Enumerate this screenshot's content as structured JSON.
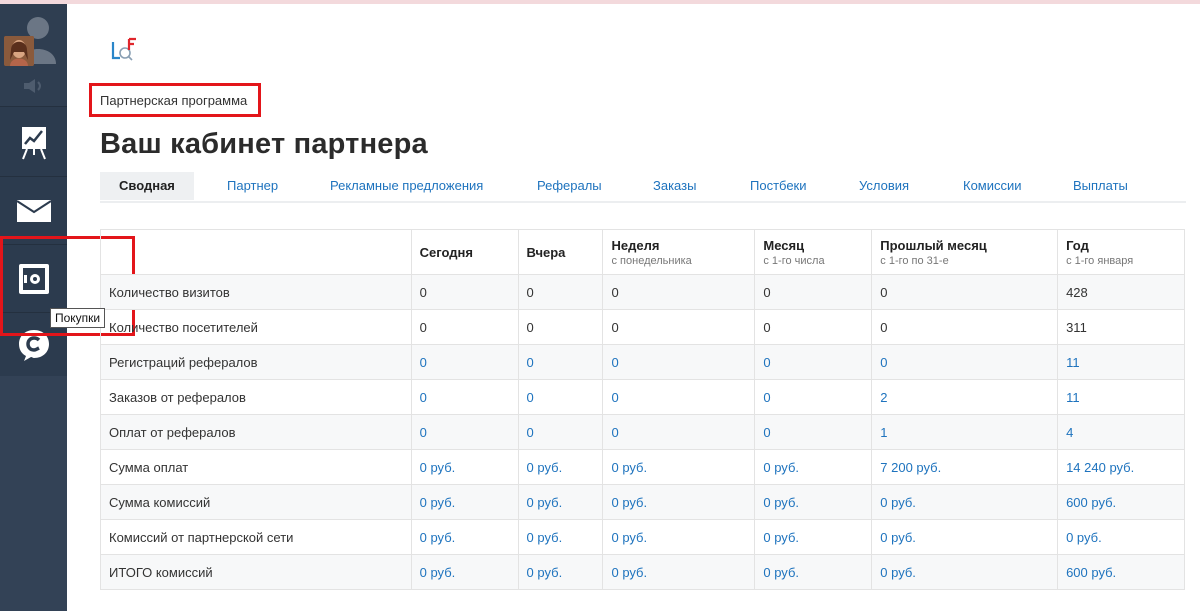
{
  "sidebar": {
    "tooltip": "Покупки",
    "items": [
      {
        "icon": "chart-easel-icon"
      },
      {
        "icon": "mail-icon"
      },
      {
        "icon": "safe-icon"
      },
      {
        "icon": "support-chat-icon"
      }
    ]
  },
  "breadcrumb": "Партнерская программа",
  "page_title": "Ваш кабинет партнера",
  "tabs": [
    {
      "label": "Сводная",
      "active": true
    },
    {
      "label": "Партнер"
    },
    {
      "label": "Рекламные предложения"
    },
    {
      "label": "Рефералы"
    },
    {
      "label": "Заказы"
    },
    {
      "label": "Постбеки"
    },
    {
      "label": "Условия"
    },
    {
      "label": "Комиссии"
    },
    {
      "label": "Выплаты"
    }
  ],
  "table": {
    "columns": [
      {
        "title": "Сегодня",
        "sub": ""
      },
      {
        "title": "Вчера",
        "sub": ""
      },
      {
        "title": "Неделя",
        "sub": "с понедельника"
      },
      {
        "title": "Месяц",
        "sub": "с 1-го числа"
      },
      {
        "title": "Прошлый месяц",
        "sub": "с 1-го по 31-е"
      },
      {
        "title": "Год",
        "sub": "с 1-го января"
      }
    ],
    "rows": [
      {
        "label": "Количество визитов",
        "values": [
          "0",
          "0",
          "0",
          "0",
          "0",
          "428"
        ]
      },
      {
        "label": "Количество посетителей",
        "values": [
          "0",
          "0",
          "0",
          "0",
          "0",
          "311"
        ]
      },
      {
        "label": "Регистраций рефералов",
        "values": [
          "0",
          "0",
          "0",
          "0",
          "0",
          "11"
        ]
      },
      {
        "label": "Заказов от рефералов",
        "values": [
          "0",
          "0",
          "0",
          "0",
          "2",
          "11"
        ]
      },
      {
        "label": "Оплат от рефералов",
        "values": [
          "0",
          "0",
          "0",
          "0",
          "1",
          "4"
        ]
      },
      {
        "label": "Сумма оплат",
        "values": [
          "0 руб.",
          "0 руб.",
          "0 руб.",
          "0 руб.",
          "7 200 руб.",
          "14 240 руб."
        ]
      },
      {
        "label": "Сумма комиссий",
        "values": [
          "0 руб.",
          "0 руб.",
          "0 руб.",
          "0 руб.",
          "0 руб.",
          "600 руб."
        ]
      },
      {
        "label": "Комиссий от партнерской сети",
        "values": [
          "0 руб.",
          "0 руб.",
          "0 руб.",
          "0 руб.",
          "0 руб.",
          "0 руб."
        ]
      },
      {
        "label": "ИТОГО комиссий",
        "values": [
          "0 руб.",
          "0 руб.",
          "0 руб.",
          "0 руб.",
          "0 руб.",
          "600 руб."
        ]
      }
    ]
  },
  "colors": {
    "sidebar": "#2c3b4e",
    "link": "#1e73be",
    "highlight": "#e3151a"
  }
}
